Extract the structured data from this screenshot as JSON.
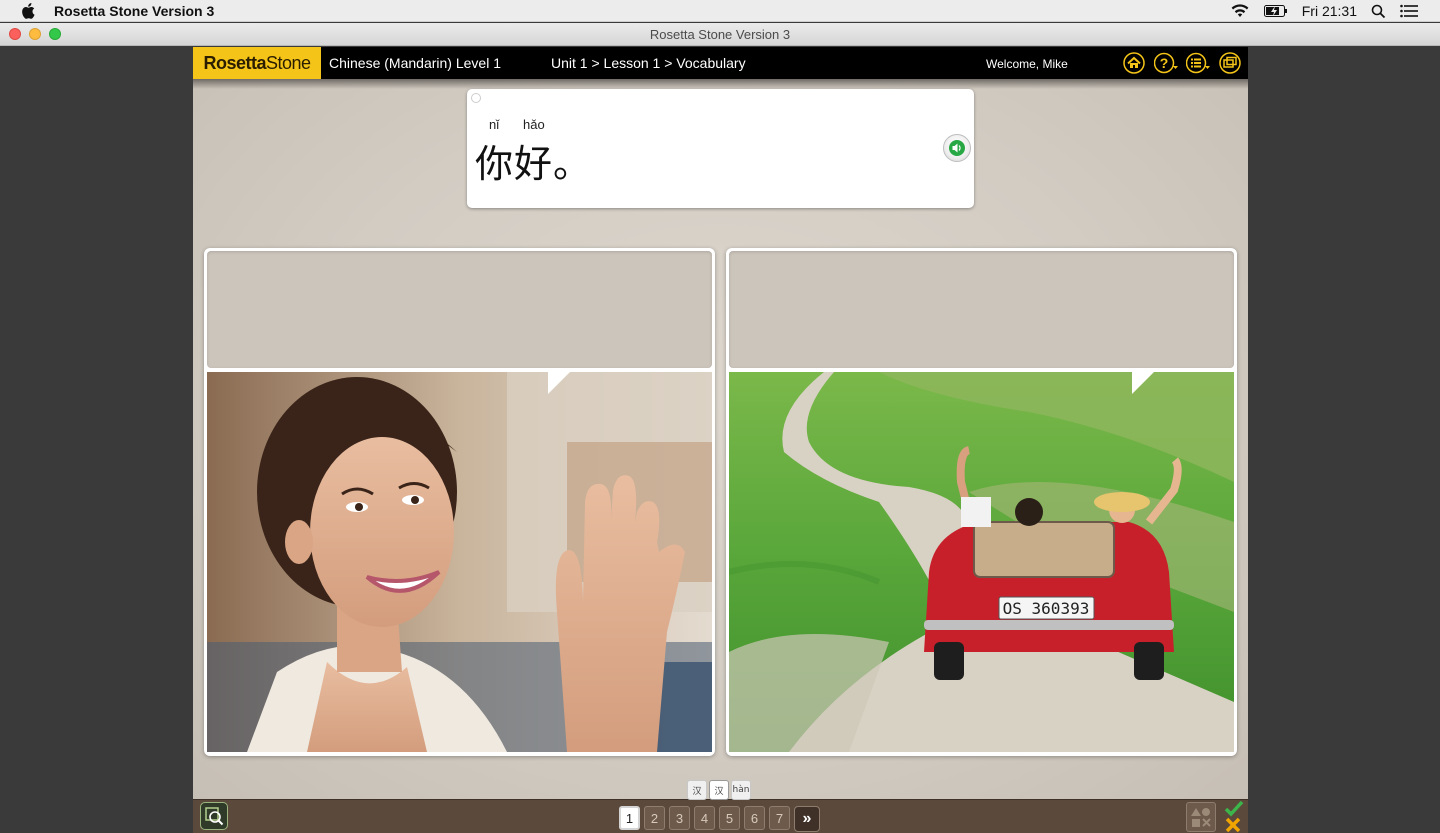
{
  "menubar": {
    "app_name": "Rosetta Stone Version 3",
    "clock": "Fri 21:31"
  },
  "window": {
    "title": "Rosetta Stone Version 3"
  },
  "app": {
    "logo_bold": "Rosetta",
    "logo_rest": "Stone",
    "course": "Chinese (Mandarin) Level 1",
    "breadcrumb": "Unit 1 > Lesson 1 > Vocabulary",
    "welcome": "Welcome, Mike"
  },
  "prompt": {
    "pinyin": [
      "nǐ",
      "hǎo"
    ],
    "text": "你好。"
  },
  "lang_switch": [
    "汉",
    "汉",
    "hàn"
  ],
  "pager": {
    "pages": [
      "1",
      "2",
      "3",
      "4",
      "5",
      "6",
      "7"
    ],
    "active": "1",
    "next": "»"
  },
  "colors": {
    "logo_bg": "#f4c418",
    "bottom_bar": "#5b4a3c",
    "check": "#3cb54a",
    "cross": "#f0a500"
  },
  "icons": {
    "top": [
      "home-icon",
      "help-icon",
      "menu-list-icon",
      "window-icon"
    ],
    "bottom": [
      "zoom-icon",
      "shapes-icon",
      "check-icon",
      "cross-icon"
    ]
  }
}
